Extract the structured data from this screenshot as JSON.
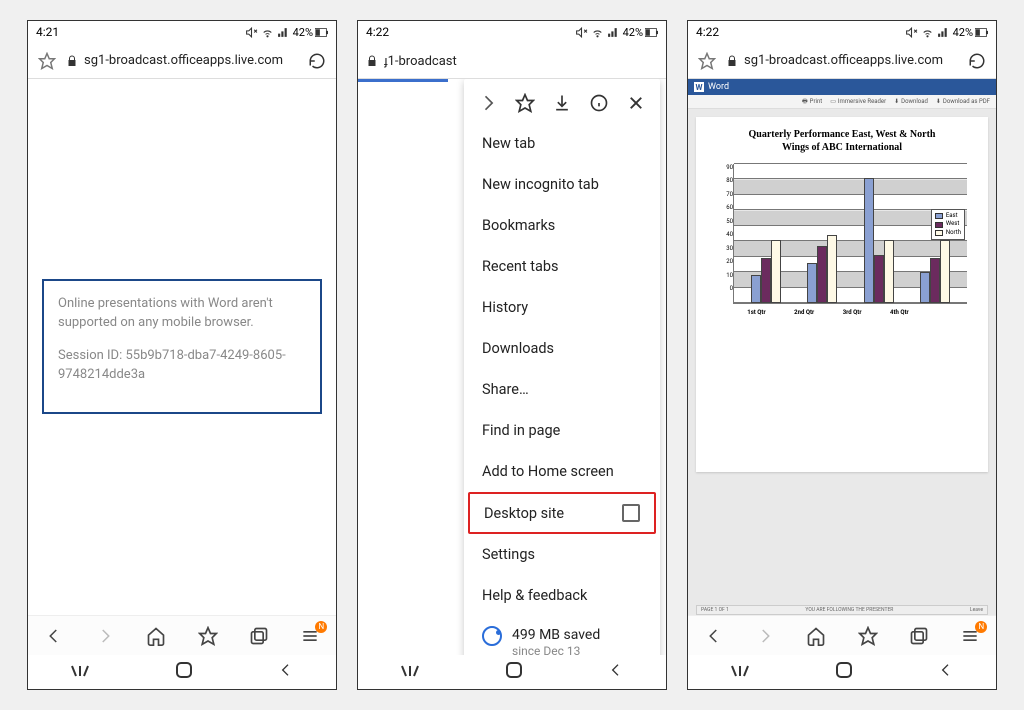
{
  "screen1": {
    "time": "4:21",
    "battery_pct": "42%",
    "url": "sg1-broadcast.officeapps.live.com",
    "error": {
      "line1": "Online presentations with Word aren't supported on any mobile browser.",
      "line2": "Session ID: 55b9b718-dba7-4249-8605-9748214dde3a"
    }
  },
  "screen2": {
    "time": "4:22",
    "battery_pct": "42%",
    "url_partial": "ɟ1-broadcast",
    "menu": {
      "items": [
        "New tab",
        "New incognito tab",
        "Bookmarks",
        "Recent tabs",
        "History",
        "Downloads",
        "Share…",
        "Find in page",
        "Add to Home screen",
        "Desktop site",
        "Settings",
        "Help & feedback"
      ],
      "highlight_index": 9,
      "saved": {
        "main": "499 MB saved",
        "sub": "since Dec 13"
      }
    }
  },
  "screen3": {
    "time": "4:22",
    "battery_pct": "42%",
    "url": "sg1-broadcast.officeapps.live.com",
    "app_label": "Word",
    "toolbar": {
      "print": "Print",
      "immersive": "Immersive Reader",
      "download": "Download",
      "pdf": "Download as PDF"
    },
    "doc_title_l1": "Quarterly Performance East, West & North",
    "doc_title_l2": "Wings of ABC International",
    "footer_left": "PAGE 1 OF 1",
    "footer_center": "YOU ARE FOLLOWING THE PRESENTER",
    "footer_right": "Leave"
  },
  "nav_badge": "N",
  "chart_data": {
    "type": "bar",
    "title": "Quarterly Performance East, West & North Wings of ABC International",
    "categories": [
      "1st Qtr",
      "2nd Qtr",
      "3rd Qtr",
      "4th Qtr"
    ],
    "series": [
      {
        "name": "East",
        "values": [
          20,
          28,
          88,
          22
        ]
      },
      {
        "name": "West",
        "values": [
          32,
          40,
          34,
          32
        ]
      },
      {
        "name": "North",
        "values": [
          44,
          48,
          44,
          44
        ]
      }
    ],
    "y_ticks": [
      0,
      10,
      20,
      30,
      40,
      50,
      60,
      70,
      80,
      90
    ],
    "ylim": [
      0,
      90
    ],
    "legend_position": "right"
  }
}
